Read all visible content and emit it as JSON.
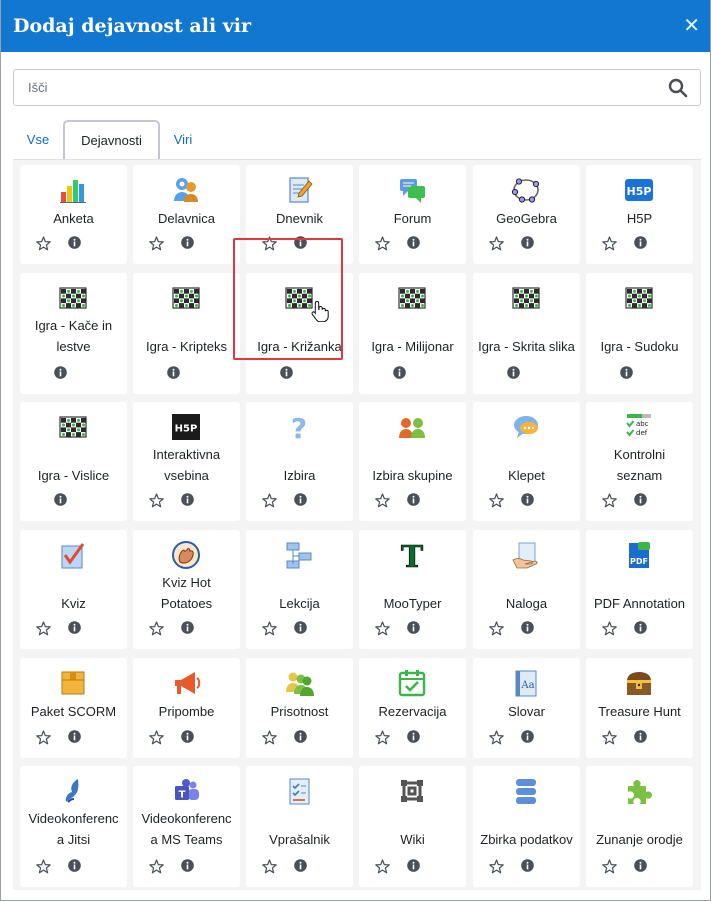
{
  "modal": {
    "title": "Dodaj dejavnost ali vir"
  },
  "search": {
    "placeholder": "Išči"
  },
  "tabs": [
    {
      "label": "Vse",
      "active": false
    },
    {
      "label": "Dejavnosti",
      "active": true
    },
    {
      "label": "Viri",
      "active": false
    }
  ],
  "activities": [
    {
      "label": "Anketa",
      "icon": "bar-chart-icon"
    },
    {
      "label": "Delavnica",
      "icon": "workshop-icon"
    },
    {
      "label": "Dnevnik",
      "icon": "journal-icon"
    },
    {
      "label": "Forum",
      "icon": "forum-icon"
    },
    {
      "label": "GeoGebra",
      "icon": "geogebra-icon"
    },
    {
      "label": "H5P",
      "icon": "h5p-icon"
    },
    {
      "label": "Igra - Kače in lestve",
      "icon": "game-board-icon"
    },
    {
      "label": "Igra - Kripteks",
      "icon": "game-board-icon"
    },
    {
      "label": "Igra - Križanka",
      "icon": "game-board-icon"
    },
    {
      "label": "Igra - Milijonar",
      "icon": "game-board-icon"
    },
    {
      "label": "Igra - Skrita slika",
      "icon": "game-board-icon"
    },
    {
      "label": "Igra - Sudoku",
      "icon": "game-board-icon"
    },
    {
      "label": "Igra - Vislice",
      "icon": "game-board-icon"
    },
    {
      "label": "Interaktivna vsebina",
      "icon": "h5p-dark-icon"
    },
    {
      "label": "Izbira",
      "icon": "question-mark-icon"
    },
    {
      "label": "Izbira skupine",
      "icon": "group-choice-icon"
    },
    {
      "label": "Klepet",
      "icon": "chat-icon"
    },
    {
      "label": "Kontrolni seznam",
      "icon": "checklist-icon"
    },
    {
      "label": "Kviz",
      "icon": "quiz-icon"
    },
    {
      "label": "Kviz Hot Potatoes",
      "icon": "hot-potatoes-icon"
    },
    {
      "label": "Lekcija",
      "icon": "lesson-icon"
    },
    {
      "label": "MooTyper",
      "icon": "mootyper-icon"
    },
    {
      "label": "Naloga",
      "icon": "assignment-icon"
    },
    {
      "label": "PDF Annotation",
      "icon": "pdf-icon"
    },
    {
      "label": "Paket SCORM",
      "icon": "scorm-package-icon"
    },
    {
      "label": "Pripombe",
      "icon": "megaphone-icon"
    },
    {
      "label": "Prisotnost",
      "icon": "attendance-icon"
    },
    {
      "label": "Rezervacija",
      "icon": "calendar-check-icon"
    },
    {
      "label": "Slovar",
      "icon": "glossary-icon"
    },
    {
      "label": "Treasure Hunt",
      "icon": "treasure-chest-icon"
    },
    {
      "label": "Videokonferenca Jitsi",
      "icon": "jitsi-icon"
    },
    {
      "label": "Videokonferenca MS Teams",
      "icon": "teams-icon"
    },
    {
      "label": "Vprašalnik",
      "icon": "questionnaire-icon"
    },
    {
      "label": "Wiki",
      "icon": "wiki-icon"
    },
    {
      "label": "Zbirka podatkov",
      "icon": "database-icon"
    },
    {
      "label": "Zunanje orodje",
      "icon": "puzzle-icon"
    }
  ],
  "label_lines": {
    "6": [
      "Igra - Kače in",
      "lestve"
    ],
    "13": [
      "Interaktivna",
      "vsebina"
    ],
    "17": [
      "Kontrolni",
      "seznam"
    ],
    "19": [
      "Kviz Hot",
      "Potatoes"
    ],
    "30": [
      "Videokonferenc",
      "a Jitsi"
    ],
    "31": [
      "Videokonferenc",
      "a MS Teams"
    ]
  },
  "info_only": [
    6,
    7,
    8,
    9,
    10,
    11,
    12
  ],
  "highlighted": 14,
  "colors": {
    "accent": "#1177d1",
    "link": "#0f6cbf",
    "highlight": "#e0383e"
  }
}
